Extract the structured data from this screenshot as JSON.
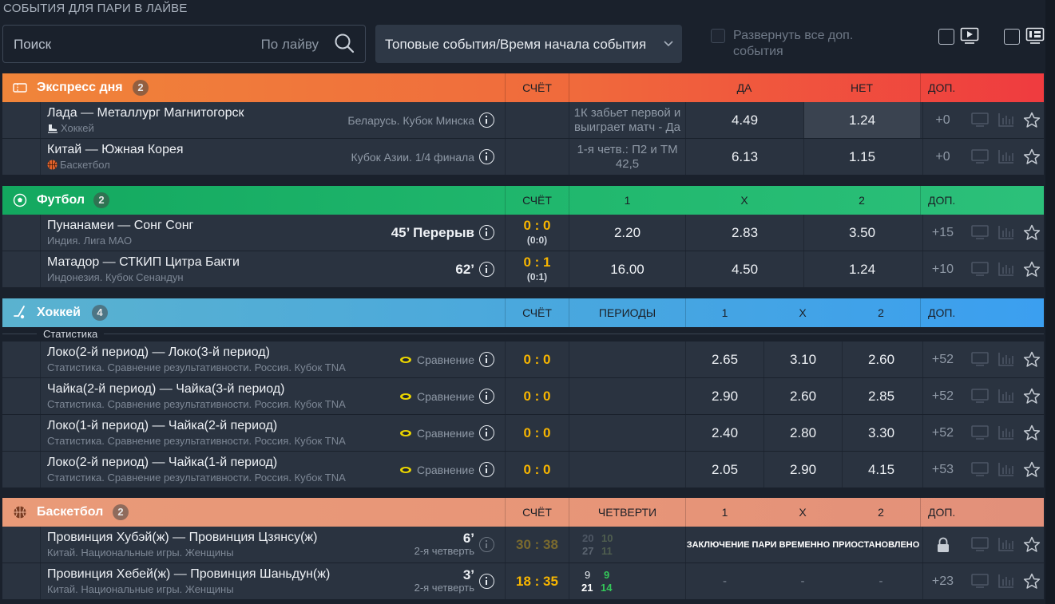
{
  "page_title": "СОБЫТИЯ ДЛЯ ПАРИ В ЛАЙВЕ",
  "search": {
    "placeholder": "Поиск",
    "scope": "По лайву"
  },
  "sort": {
    "value": "Топовые события/Время начала события"
  },
  "expand_all": {
    "label": "Развернуть все доп. события"
  },
  "icons": {
    "search": "search-icon",
    "chevron": "chevron-down-icon",
    "video": "video-icon",
    "scoreboard": "scoreboard-icon",
    "tv": "tv-icon",
    "stats": "stats-icon",
    "star": "star-icon",
    "info": "info-icon",
    "lock": "lock-icon"
  },
  "colors": {
    "express": "#f0853a",
    "football": "#1fb56b",
    "hockey": "#3fa9e6",
    "basketball": "#e39375",
    "score": "#f7b500",
    "quarter_win": "#34c759"
  },
  "express": {
    "title": "Экспресс дня",
    "count": "2",
    "headers": {
      "score": "СЧЁТ",
      "yes": "ДА",
      "no": "НЕТ",
      "more": "ДОП."
    },
    "rows": [
      {
        "title": "Лада — Металлург Магнитогорск",
        "sport": "Хоккей",
        "tournament": "Беларусь. Кубок Минска",
        "condition": "1К забьет первой и выиграет матч - Да",
        "yes": "4.49",
        "no": "1.24",
        "more": "+0"
      },
      {
        "title": "Китай — Южная Корея",
        "sport": "Баскетбол",
        "tournament": "Кубок Азии. 1/4 финала",
        "condition": "1-я четв.: П2 и ТМ 42,5",
        "yes": "6.13",
        "no": "1.15",
        "more": "+0"
      }
    ]
  },
  "football": {
    "title": "Футбол",
    "count": "2",
    "headers": {
      "score": "СЧЁТ",
      "c1": "1",
      "cx": "X",
      "c2": "2",
      "more": "ДОП."
    },
    "rows": [
      {
        "title": "Пунанамеи — Сонг Сонг",
        "league": "Индия. Лига МАО",
        "time": "45’ Перерыв",
        "score": "0 : 0",
        "half": "(0:0)",
        "o1": "2.20",
        "ox": "2.83",
        "o2": "3.50",
        "more": "+15"
      },
      {
        "title": "Матадор — СТКИП Цитра Бакти",
        "league": "Индонезия. Кубок Сенандун",
        "time": "62’",
        "score": "0 : 1",
        "half": "(0:1)",
        "o1": "16.00",
        "ox": "4.50",
        "o2": "1.24",
        "more": "+10"
      }
    ]
  },
  "hockey": {
    "title": "Хоккей",
    "count": "4",
    "headers": {
      "score": "СЧЁТ",
      "periods": "ПЕРИОДЫ",
      "c1": "1",
      "cx": "X",
      "c2": "2",
      "more": "ДОП."
    },
    "group_label": "Статистика",
    "rows": [
      {
        "title": "Локо(2-й период) — Локо(3-й период)",
        "league": "Статистика. Сравнение результативности. Россия. Кубок TNA",
        "compare": "Сравнение",
        "score": "0 : 0",
        "o1": "2.65",
        "ox": "3.10",
        "o2": "2.60",
        "more": "+52"
      },
      {
        "title": "Чайка(2-й период) — Чайка(3-й период)",
        "league": "Статистика. Сравнение результативности. Россия. Кубок TNA",
        "compare": "Сравнение",
        "score": "0 : 0",
        "o1": "2.90",
        "ox": "2.60",
        "o2": "2.85",
        "more": "+52"
      },
      {
        "title": "Локо(1-й период) — Чайка(2-й период)",
        "league": "Статистика. Сравнение результативности. Россия. Кубок TNA",
        "compare": "Сравнение",
        "score": "0 : 0",
        "o1": "2.40",
        "ox": "2.80",
        "o2": "3.30",
        "more": "+52"
      },
      {
        "title": "Локо(2-й период) — Чайка(1-й период)",
        "league": "Статистика. Сравнение результативности. Россия. Кубок TNA",
        "compare": "Сравнение",
        "score": "0 : 0",
        "o1": "2.05",
        "ox": "2.90",
        "o2": "4.15",
        "more": "+53"
      }
    ]
  },
  "basketball": {
    "title": "Баскетбол",
    "count": "2",
    "headers": {
      "score": "СЧЁТ",
      "quarters": "ЧЕТВЕРТИ",
      "c1": "1",
      "cx": "X",
      "c2": "2",
      "more": "ДОП."
    },
    "rows": [
      {
        "title": "Провинция Хубэй(ж) — Провинция Цзянсу(ж)",
        "league": "Китай. Национальные игры. Женщины",
        "time": "6’",
        "period": "2-я четверть",
        "score": "30 : 38",
        "q_top": [
          "20",
          "10"
        ],
        "q_bot": [
          "27",
          "11"
        ],
        "suspended": "ЗАКЛЮЧЕНИЕ ПАРИ ВРЕМЕННО ПРИОСТАНОВЛЕНО"
      },
      {
        "title": "Провинция Хебей(ж) — Провинция Шаньдун(ж)",
        "league": "Китай. Национальные игры. Женщины",
        "time": "3’",
        "period": "2-я четверть",
        "score": "18 : 35",
        "q_top": [
          "9",
          "9"
        ],
        "q_bot": [
          "21",
          "14"
        ],
        "o1": "-",
        "ox": "-",
        "o2": "-",
        "more": "+23"
      }
    ]
  }
}
